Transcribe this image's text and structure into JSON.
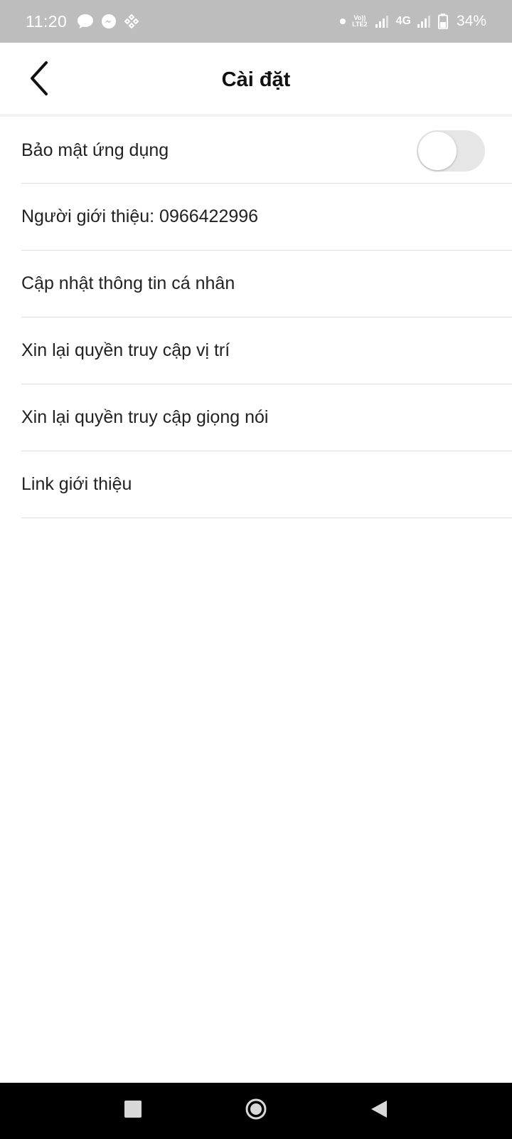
{
  "status_bar": {
    "time": "11:20",
    "network_4g": "4G",
    "volte_top": "Vo))",
    "volte_bottom": "LTE2",
    "battery_percent": "34%",
    "icons": [
      "chat-bubble-icon",
      "messenger-icon",
      "app-notification-icon",
      "dot-icon",
      "volte-icon",
      "signal-icon",
      "signal-icon",
      "battery-icon"
    ]
  },
  "header": {
    "title": "Cài đặt",
    "back_icon": "chevron-left-icon"
  },
  "settings": {
    "items": [
      {
        "label": "Bảo mật ứng dụng",
        "toggle": false
      },
      {
        "label": "Người giới thiệu: 0966422996"
      },
      {
        "label": "Cập nhật thông tin cá nhân"
      },
      {
        "label": "Xin lại quyền truy cập vị trí"
      },
      {
        "label": "Xin lại quyền truy cập giọng nói"
      },
      {
        "label": "Link giới thiệu"
      }
    ]
  },
  "nav_bar": {
    "buttons": [
      "recents-square-icon",
      "home-circle-icon",
      "back-triangle-icon"
    ]
  },
  "colors": {
    "status_bar_bg": "#bdbdbd",
    "toggle_off_track": "#e6e6e6",
    "divider": "#dcdcdc",
    "nav_bar_bg": "#000000"
  }
}
